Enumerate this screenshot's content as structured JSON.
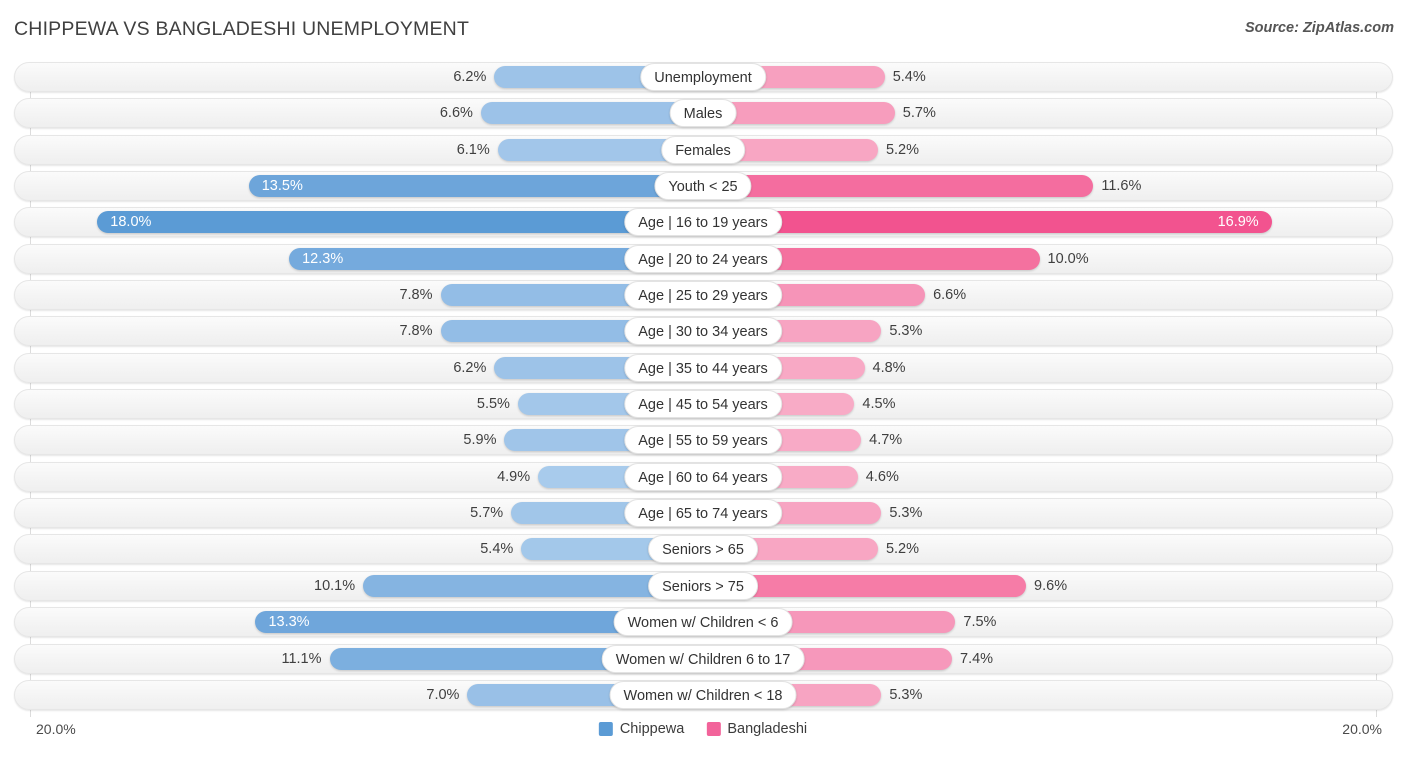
{
  "header": {
    "title": "CHIPPEWA VS BANGLADESHI UNEMPLOYMENT",
    "source": "Source: ZipAtlas.com"
  },
  "legend": {
    "items": [
      {
        "label": "Chippewa",
        "color": "#5b9bd5"
      },
      {
        "label": "Bangladeshi",
        "color": "#f2639a"
      }
    ]
  },
  "axis": {
    "left_min": "20.0%",
    "right_min": "20.0%"
  },
  "chart_data": {
    "type": "bar",
    "title": "CHIPPEWA VS BANGLADESHI UNEMPLOYMENT",
    "orientation": "horizontal-diverging",
    "xlabel": "",
    "ylabel": "",
    "axis_max": 20.0,
    "unit": "%",
    "grid": true,
    "legend_position": "bottom-center",
    "categories": [
      "Unemployment",
      "Males",
      "Females",
      "Youth < 25",
      "Age | 16 to 19 years",
      "Age | 20 to 24 years",
      "Age | 25 to 29 years",
      "Age | 30 to 34 years",
      "Age | 35 to 44 years",
      "Age | 45 to 54 years",
      "Age | 55 to 59 years",
      "Age | 60 to 64 years",
      "Age | 65 to 74 years",
      "Seniors > 65",
      "Seniors > 75",
      "Women w/ Children < 6",
      "Women w/ Children 6 to 17",
      "Women w/ Children < 18"
    ],
    "series": [
      {
        "name": "Chippewa",
        "color": "#5b9bd5",
        "side": "left",
        "values": [
          6.2,
          6.6,
          6.1,
          13.5,
          18.0,
          12.3,
          7.8,
          7.8,
          6.2,
          5.5,
          5.9,
          4.9,
          5.7,
          5.4,
          10.1,
          13.3,
          11.1,
          7.0
        ]
      },
      {
        "name": "Bangladeshi",
        "color": "#f2639a",
        "side": "right",
        "values": [
          5.4,
          5.7,
          5.2,
          11.6,
          16.9,
          10.0,
          6.6,
          5.3,
          4.8,
          4.5,
          4.7,
          4.6,
          5.3,
          5.2,
          9.6,
          7.5,
          7.4,
          5.3
        ]
      }
    ]
  },
  "rows": [
    {
      "label": "Unemployment",
      "left": "6.2%",
      "right": "5.4%",
      "lv": 6.2,
      "rv": 5.4,
      "lcolor": "#9dc3e8",
      "rcolor": "#f7a0bf",
      "lin": false,
      "rin": false
    },
    {
      "label": "Males",
      "left": "6.6%",
      "right": "5.7%",
      "lv": 6.6,
      "rv": 5.7,
      "lcolor": "#9cc2e8",
      "rcolor": "#f79dbd",
      "lin": false,
      "rin": false
    },
    {
      "label": "Females",
      "left": "6.1%",
      "right": "5.2%",
      "lv": 6.1,
      "rv": 5.2,
      "lcolor": "#a2c6ea",
      "rcolor": "#f8a6c3",
      "lin": false,
      "rin": false
    },
    {
      "label": "Youth < 25",
      "left": "13.5%",
      "right": "11.6%",
      "lv": 13.5,
      "rv": 11.6,
      "lcolor": "#6da5da",
      "rcolor": "#f46d9f",
      "lin": true,
      "rin": false
    },
    {
      "label": "Age | 16 to 19 years",
      "left": "18.0%",
      "right": "16.9%",
      "lv": 18.0,
      "rv": 16.9,
      "lcolor": "#5b9bd5",
      "rcolor": "#f2538f",
      "lin": true,
      "rin": true
    },
    {
      "label": "Age | 20 to 24 years",
      "left": "12.3%",
      "right": "10.0%",
      "lv": 12.3,
      "rv": 10.0,
      "lcolor": "#75aadd",
      "rcolor": "#f4719f",
      "lin": true,
      "rin": false
    },
    {
      "label": "Age | 25 to 29 years",
      "left": "7.8%",
      "right": "6.6%",
      "lv": 7.8,
      "rv": 6.6,
      "lcolor": "#93bde6",
      "rcolor": "#f694b8",
      "lin": false,
      "rin": false
    },
    {
      "label": "Age | 30 to 34 years",
      "left": "7.8%",
      "right": "5.3%",
      "lv": 7.8,
      "rv": 5.3,
      "lcolor": "#93bde6",
      "rcolor": "#f7a4c2",
      "lin": false,
      "rin": false
    },
    {
      "label": "Age | 35 to 44 years",
      "left": "6.2%",
      "right": "4.8%",
      "lv": 6.2,
      "rv": 4.8,
      "lcolor": "#9dc3e8",
      "rcolor": "#f8a9c5",
      "lin": false,
      "rin": false
    },
    {
      "label": "Age | 45 to 54 years",
      "left": "5.5%",
      "right": "4.5%",
      "lv": 5.5,
      "rv": 4.5,
      "lcolor": "#a3c7ea",
      "rcolor": "#f8abc6",
      "lin": false,
      "rin": false
    },
    {
      "label": "Age | 55 to 59 years",
      "left": "5.9%",
      "right": "4.7%",
      "lv": 5.9,
      "rv": 4.7,
      "lcolor": "#a0c5e9",
      "rcolor": "#f8aac6",
      "lin": false,
      "rin": false
    },
    {
      "label": "Age | 60 to 64 years",
      "left": "4.9%",
      "right": "4.6%",
      "lv": 4.9,
      "rv": 4.6,
      "lcolor": "#a8cbec",
      "rcolor": "#f8abc6",
      "lin": false,
      "rin": false
    },
    {
      "label": "Age | 65 to 74 years",
      "left": "5.7%",
      "right": "5.3%",
      "lv": 5.7,
      "rv": 5.3,
      "lcolor": "#a1c6e9",
      "rcolor": "#f7a4c2",
      "lin": false,
      "rin": false
    },
    {
      "label": "Seniors > 65",
      "left": "5.4%",
      "right": "5.2%",
      "lv": 5.4,
      "rv": 5.2,
      "lcolor": "#a3c8ea",
      "rcolor": "#f8a6c3",
      "lin": false,
      "rin": false
    },
    {
      "label": "Seniors > 75",
      "left": "10.1%",
      "right": "9.6%",
      "lv": 10.1,
      "rv": 9.6,
      "lcolor": "#85b4e1",
      "rcolor": "#f67ca7",
      "lin": false,
      "rin": false
    },
    {
      "label": "Women w/ Children < 6",
      "left": "13.3%",
      "right": "7.5%",
      "lv": 13.3,
      "rv": 7.5,
      "lcolor": "#6fa6db",
      "rcolor": "#f697ba",
      "lin": true,
      "rin": false
    },
    {
      "label": "Women w/ Children 6 to 17",
      "left": "11.1%",
      "right": "7.4%",
      "lv": 11.1,
      "rv": 7.4,
      "lcolor": "#7cafdf",
      "rcolor": "#f698bb",
      "lin": false,
      "rin": false
    },
    {
      "label": "Women w/ Children < 18",
      "left": "7.0%",
      "right": "5.3%",
      "lv": 7.0,
      "rv": 5.3,
      "lcolor": "#99c0e7",
      "rcolor": "#f7a4c2",
      "lin": false,
      "rin": false
    }
  ]
}
